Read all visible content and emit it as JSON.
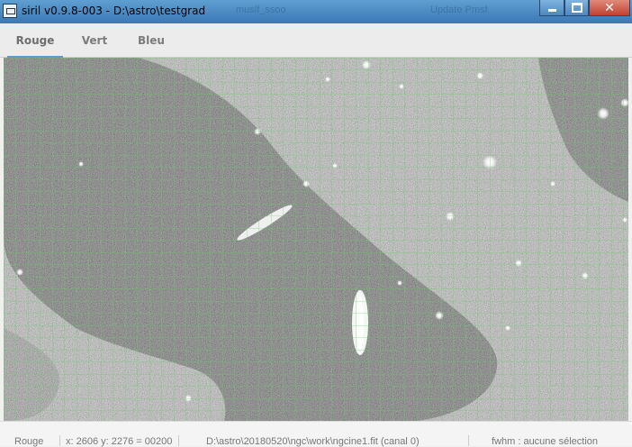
{
  "window": {
    "title": "siril v0.9.8-003 - D:\\astro\\testgrad",
    "background_titles": [
      "muslf_ssoo",
      "Update Pmsf"
    ],
    "controls": {
      "minimize_icon": "minimize-icon",
      "maximize_icon": "maximize-icon",
      "close_icon": "close-icon"
    }
  },
  "tabs": [
    {
      "label": "Rouge",
      "active": true
    },
    {
      "label": "Vert",
      "active": false
    },
    {
      "label": "Bleu",
      "active": false
    }
  ],
  "statusbar": {
    "channel": "Rouge",
    "coords": "x: 2606 y: 2276 = 00200",
    "file": "D:\\astro\\20180520\\ngc\\work\\ngcine1.fit (canal 0)",
    "fwhm": "fwhm : aucune sélection"
  },
  "colors": {
    "grid": "#5fd15f",
    "titlebar": "#4a88c4",
    "tab_indicator": "#5a9bd6"
  }
}
